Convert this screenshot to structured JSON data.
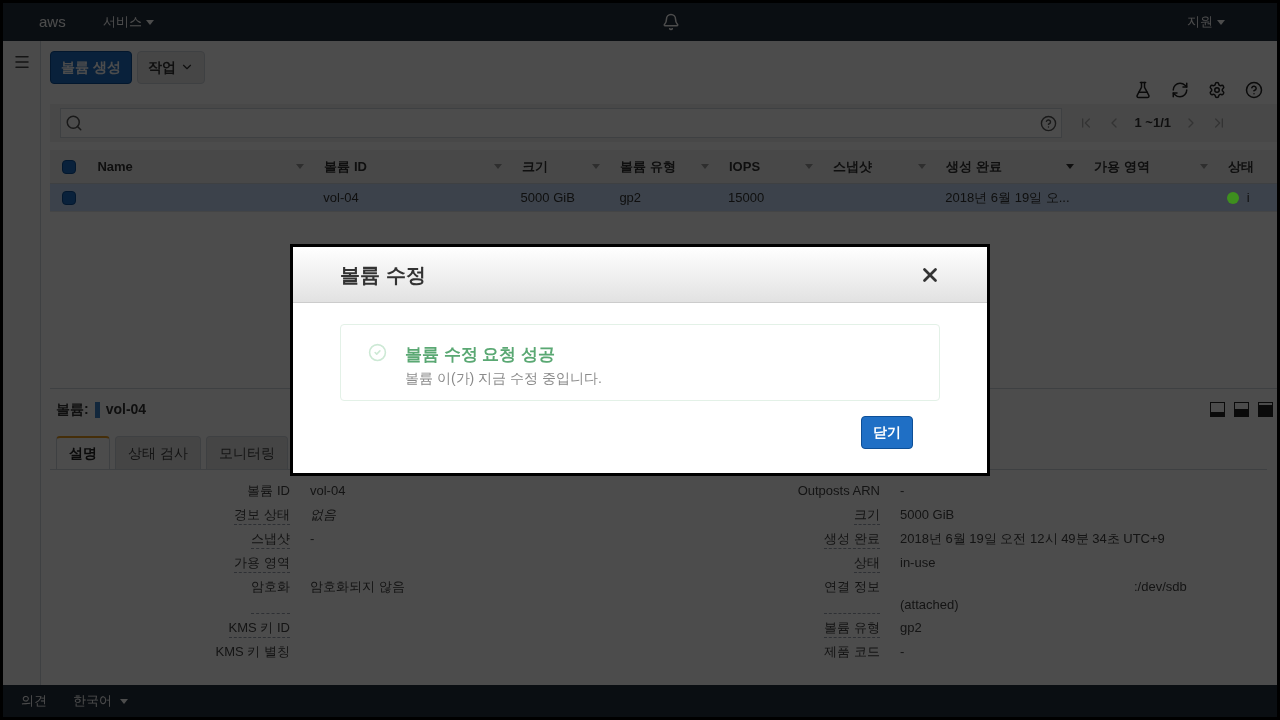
{
  "top_bar": {
    "logo": "aws",
    "services_menu": "서비스",
    "support_menu": "지원"
  },
  "toolbar": {
    "buttons": [
      {
        "label": "볼륨 생성",
        "kind": "primary"
      },
      {
        "label": "작업",
        "kind": "dropdown"
      }
    ]
  },
  "search": {
    "pagination": "1 ~1/1"
  },
  "table": {
    "all_checked": true,
    "columns": [
      "Name",
      "볼륨 ID",
      "크기",
      "볼륨 유형",
      "IOPS",
      "스냅샷",
      "생성 완료",
      "가용 영역",
      "상태"
    ],
    "rows": [
      {
        "selected": true,
        "checked": true,
        "volume_id": "vol-04",
        "size": "5000 GiB",
        "volume_type": "gp2",
        "iops": "15000",
        "created": "2018년 6월 19일 오...",
        "status": {
          "text": "i",
          "color": "#3e8f1e"
        }
      }
    ]
  },
  "detail": {
    "label": "볼륨:",
    "volume": "vol-04",
    "tabs": [
      {
        "label": "설명",
        "selected": true
      },
      {
        "label": "상태 검사",
        "selected": false
      },
      {
        "label": "모니터링",
        "selected": false
      }
    ],
    "rows": [
      {
        "left": {
          "label": "볼륨 ID",
          "value": "vol-04",
          "help": false,
          "kind": "plain"
        },
        "right": {
          "label": "Outposts ARN",
          "value": "-",
          "help": false,
          "kind": "plain"
        }
      },
      {
        "left": {
          "label": "경보 상태",
          "value": "없음",
          "help": true,
          "kind": "italic"
        },
        "right": {
          "label": "크기",
          "value": "5000 GiB",
          "help": true,
          "kind": "plain"
        }
      },
      {
        "left": {
          "label": "스냅샷",
          "value": "-",
          "help": true,
          "kind": "plain"
        },
        "right": {
          "label": "생성 완료",
          "value": "2018년 6월 19일 오전 12시 49분 34초 UTC+9",
          "help": true,
          "kind": "plain"
        }
      },
      {
        "left": {
          "label": "가용 영역",
          "help": true
        },
        "right": {
          "label": "상태",
          "value": "in-use",
          "help": true,
          "kind": "plain"
        }
      },
      {
        "left": {
          "label": "암호화",
          "value": "암호화되지 않음",
          "help": true,
          "kind": "plain"
        },
        "right": {
          "label": "연결 정보",
          "value": ":/dev/sdb",
          "note": "(attached)",
          "help": true,
          "kind": "attachment"
        }
      },
      {
        "left": {
          "label": "KMS 키 ID",
          "help": true
        },
        "right": {
          "label": "볼륨 유형",
          "value": "gp2",
          "help": true,
          "kind": "plain"
        }
      },
      {
        "left": {
          "label": "KMS 키 별칭",
          "help": false
        },
        "right": {
          "label": "제품 코드",
          "value": "-",
          "help": false,
          "kind": "plain"
        }
      }
    ]
  },
  "modal": {
    "title": "볼륨 수정",
    "alert": {
      "title": "볼륨 수정 요청 성공",
      "message": "볼륨 이(가) 지금 수정 중입니다."
    },
    "buttons": [
      "닫기"
    ]
  },
  "footer": {
    "feedback": "의견",
    "language": "한국어"
  }
}
